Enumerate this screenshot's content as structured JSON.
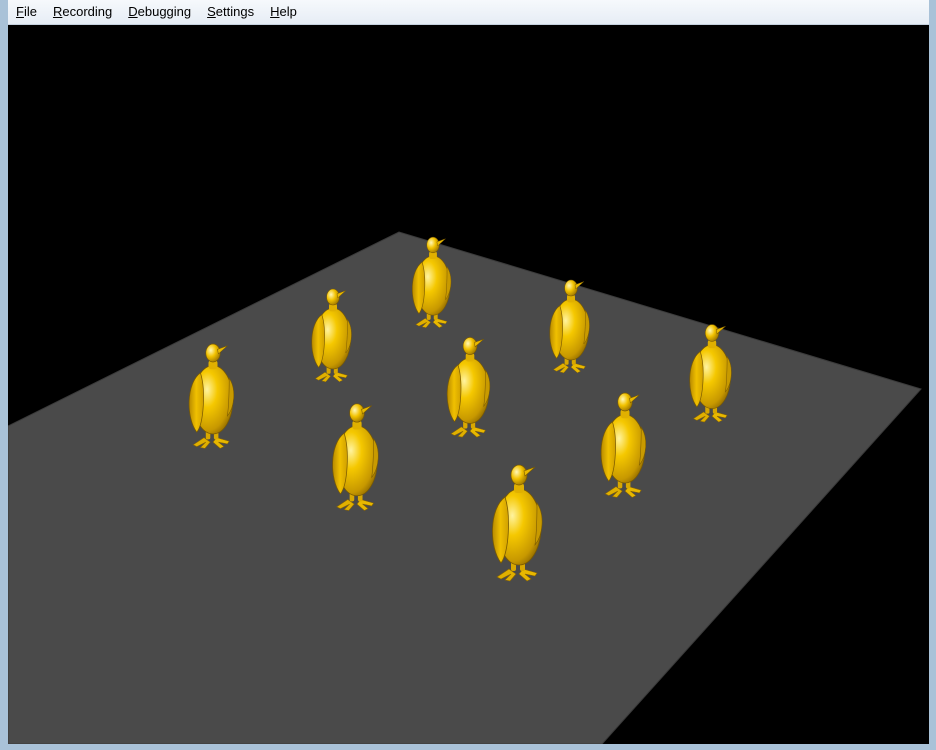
{
  "menu": {
    "items": [
      {
        "accel": "F",
        "rest": "ile"
      },
      {
        "accel": "R",
        "rest": "ecording"
      },
      {
        "accel": "D",
        "rest": "ebugging"
      },
      {
        "accel": "S",
        "rest": "ettings"
      },
      {
        "accel": "H",
        "rest": "elp"
      }
    ]
  },
  "scene": {
    "background_color": "#000000",
    "floor_color": "#4a4a4a",
    "penguin_color": "#f2c200",
    "penguin_count": 9
  }
}
